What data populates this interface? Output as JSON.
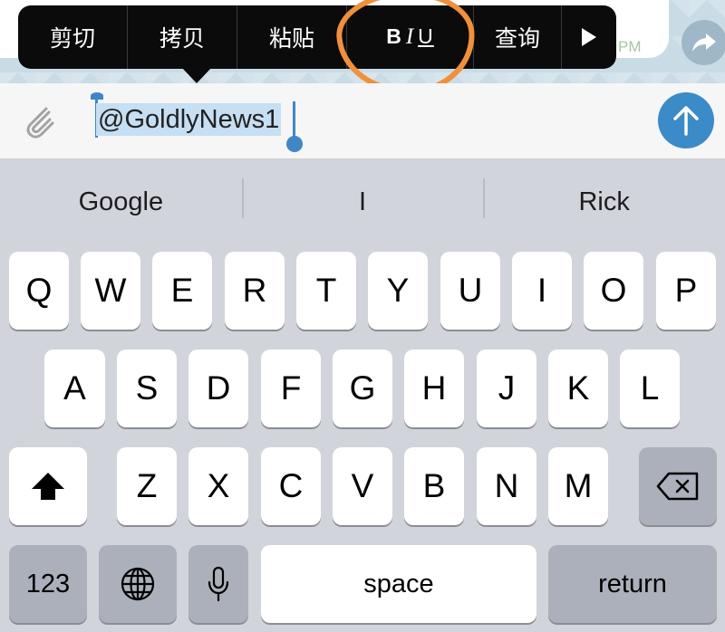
{
  "chat": {
    "time_label": "PM"
  },
  "context_menu": {
    "items": [
      {
        "label": "剪切"
      },
      {
        "label": "拷贝"
      },
      {
        "label": "粘贴"
      },
      {
        "label_b": "B",
        "label_i": "I",
        "label_u": "U"
      },
      {
        "label": "查询"
      }
    ]
  },
  "composer": {
    "text": "@GoldlyNews1"
  },
  "suggestions": [
    "Google",
    "I",
    "Rick"
  ],
  "keyboard": {
    "row1": [
      "Q",
      "W",
      "E",
      "R",
      "T",
      "Y",
      "U",
      "I",
      "O",
      "P"
    ],
    "row2": [
      "A",
      "S",
      "D",
      "F",
      "G",
      "H",
      "J",
      "K",
      "L"
    ],
    "row3": [
      "Z",
      "X",
      "C",
      "V",
      "B",
      "N",
      "M"
    ],
    "numbers_label": "123",
    "space_label": "space",
    "return_label": "return"
  },
  "colors": {
    "accent": "#3a8bc8",
    "annotation": "#f0903a"
  }
}
